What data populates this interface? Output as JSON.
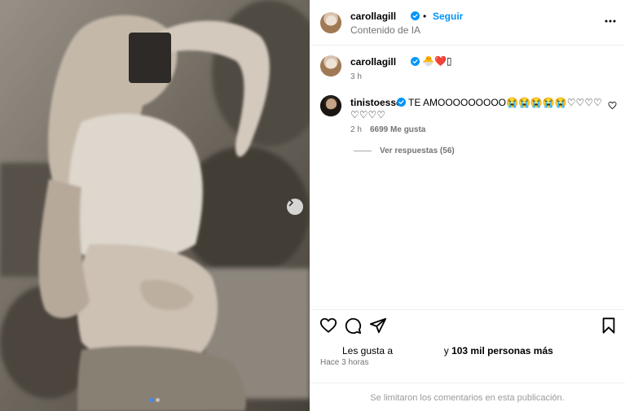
{
  "post": {
    "username": "carollagill",
    "follow_label": "Seguir",
    "sep": "•",
    "subtitle": "Contenido de IA",
    "caption_emojis": "🐣❤️▯",
    "caption_time": "3 h"
  },
  "comments": [
    {
      "username": "tinistoessel",
      "text_line1": "TE AMOOOOOOOOO😭😭😭😭😭♡♡♡♡",
      "text_line2": "♡♡♡♡",
      "time": "2 h",
      "likes": "6699 Me gusta",
      "replies": "Ver respuestas (56)"
    }
  ],
  "footer": {
    "likes_prefix": "Les gusta a",
    "likes_suffix": "y",
    "likes_count": "103 mil personas más",
    "time_ago": "Hace 3 horas",
    "limited_notice": "Se limitaron los comentarios en esta publicación."
  },
  "icons": {
    "verified": "verified-badge-icon",
    "more": "more-horizontal-icon",
    "heart": "heart-icon",
    "comment": "comment-icon",
    "share": "paper-plane-icon",
    "save": "bookmark-icon",
    "next": "chevron-right-icon"
  },
  "colors": {
    "accent": "#0095f6",
    "verified": "#0095f6",
    "muted": "#737373"
  },
  "carousel": {
    "total": 2,
    "active": 1
  }
}
